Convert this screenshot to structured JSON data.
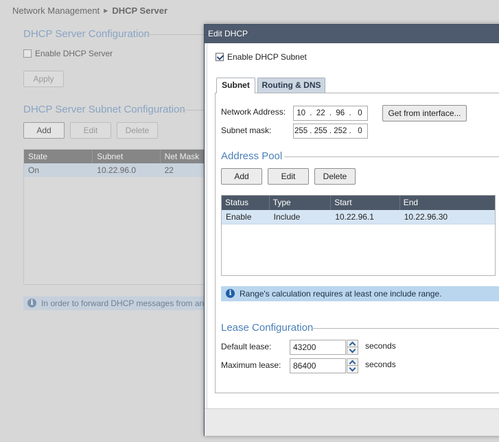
{
  "breadcrumb": {
    "parent": "Network Management",
    "current": "DHCP Server"
  },
  "background": {
    "config_title": "DHCP Server Configuration",
    "enable_label": "Enable DHCP Server",
    "apply_label": "Apply",
    "subnet_title": "DHCP Server Subnet Configuration",
    "buttons": {
      "add": "Add",
      "edit": "Edit",
      "delete": "Delete"
    },
    "table": {
      "headers": [
        "State",
        "Subnet",
        "Net Mask"
      ],
      "rows": [
        {
          "state": "On",
          "subnet": "10.22.96.0",
          "mask": "22"
        }
      ]
    },
    "info_text": "In order to forward DHCP messages from anothe"
  },
  "dialog": {
    "title": "Edit DHCP",
    "enable_subnet_label": "Enable DHCP Subnet",
    "enable_subnet_checked": true,
    "tabs": {
      "subnet": "Subnet",
      "routing": "Routing & DNS"
    },
    "network_address_label": "Network Address:",
    "network_address": [
      "10",
      "22",
      "96",
      "0"
    ],
    "subnet_mask_label": "Subnet mask:",
    "subnet_mask": [
      "255",
      "255",
      "252",
      "0"
    ],
    "get_from_interface": "Get from interface...",
    "address_pool": {
      "title": "Address Pool",
      "add": "Add",
      "edit": "Edit",
      "delete": "Delete",
      "headers": {
        "status": "Status",
        "type": "Type",
        "start": "Start",
        "end": "End"
      },
      "row": {
        "status": "Enable",
        "type": "Include",
        "start": "10.22.96.1",
        "end": "10.22.96.30"
      }
    },
    "info_text": "Range's calculation requires at least one include range.",
    "lease": {
      "title": "Lease Configuration",
      "default_label": "Default lease:",
      "default_value": "43200",
      "max_label": "Maximum lease:",
      "max_value": "86400",
      "unit": "seconds"
    }
  },
  "colors": {
    "dialog_title_bg": "#4e5a6d",
    "accent_blue": "#4c7fb6",
    "info_bg": "#bad6ef",
    "table_header": "#4c5867"
  },
  "icons": {
    "breadcrumb_separator": "triangle-right-icon",
    "info": "info-icon"
  }
}
